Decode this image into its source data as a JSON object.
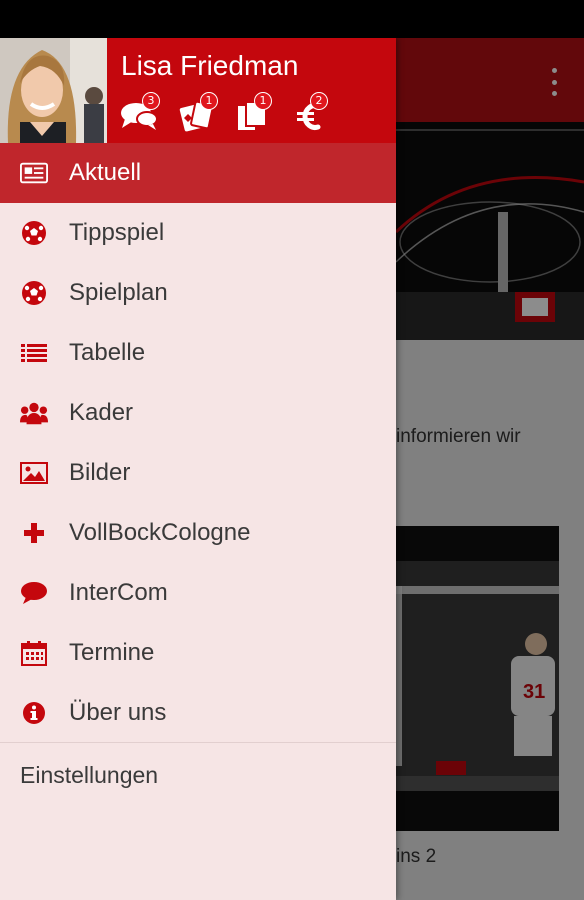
{
  "user": {
    "name": "Lisa Friedman"
  },
  "header_icons": [
    {
      "icon": "chat-bubbles-icon",
      "count": "3"
    },
    {
      "icon": "cards-icon",
      "count": "1"
    },
    {
      "icon": "documents-icon",
      "count": "1"
    },
    {
      "icon": "euro-icon",
      "count": "2"
    }
  ],
  "menu": {
    "items": [
      {
        "label": "Aktuell",
        "icon": "newspaper-icon",
        "active": true
      },
      {
        "label": "Tippspiel",
        "icon": "soccer-ball-icon"
      },
      {
        "label": "Spielplan",
        "icon": "soccer-ball-icon"
      },
      {
        "label": "Tabelle",
        "icon": "list-icon"
      },
      {
        "label": "Kader",
        "icon": "group-icon"
      },
      {
        "label": "Bilder",
        "icon": "picture-icon"
      },
      {
        "label": "VollBockCologne",
        "icon": "plus-icon"
      },
      {
        "label": "InterCom",
        "icon": "speech-bubble-icon"
      },
      {
        "label": "Termine",
        "icon": "calendar-icon"
      },
      {
        "label": "Über uns",
        "icon": "info-icon"
      }
    ],
    "settings_label": "Einstellungen"
  },
  "background": {
    "text_line": "informieren wir",
    "card_caption": "ins 2"
  },
  "colors": {
    "brand_red": "#c4070d",
    "active_row": "#c0262c",
    "drawer_bg": "#f6e5e5",
    "icon_red": "#c4070d"
  }
}
